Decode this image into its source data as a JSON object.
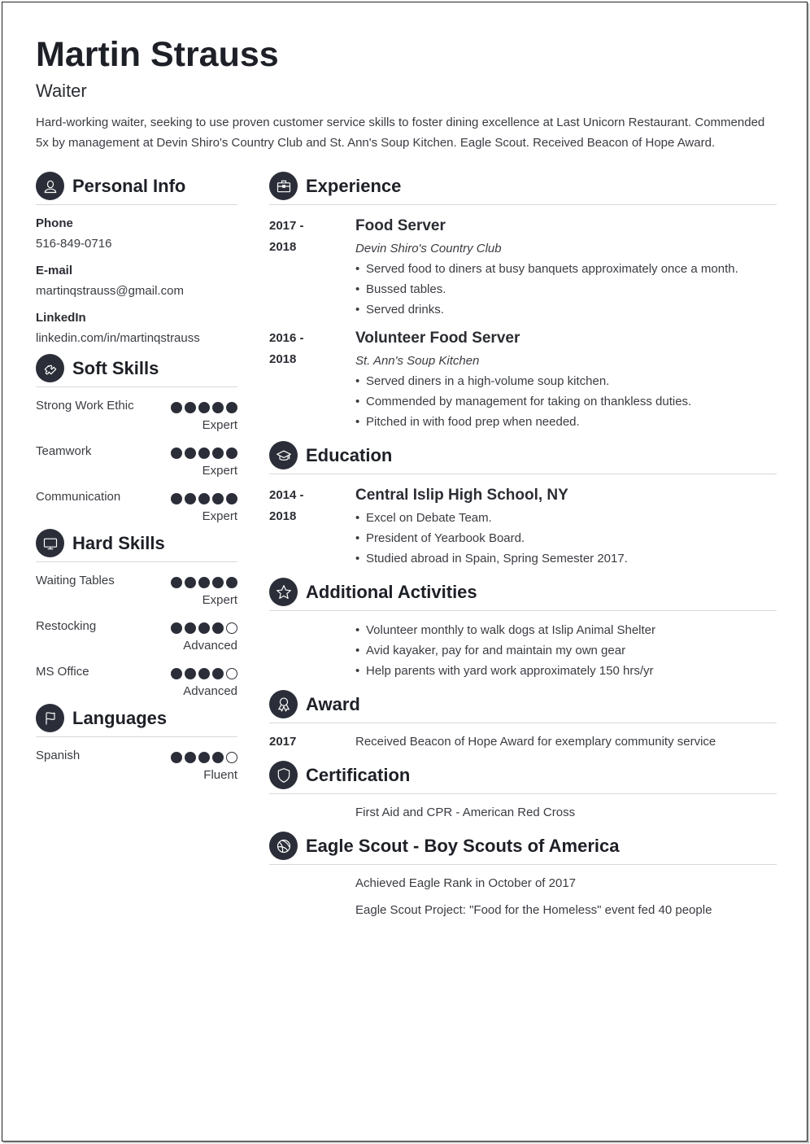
{
  "header": {
    "name": "Martin Strauss",
    "title": "Waiter",
    "summary": "Hard-working waiter, seeking to use proven customer service skills to foster dining excellence at Last Unicorn Restaurant. Commended 5x by management at Devin Shiro's Country Club and St. Ann's Soup Kitchen. Eagle Scout. Received Beacon of Hope Award."
  },
  "personal_info": {
    "title": "Personal Info",
    "icon": "person-icon",
    "fields": [
      {
        "label": "Phone",
        "value": "516-849-0716"
      },
      {
        "label": "E-mail",
        "value": "martinqstrauss@gmail.com"
      },
      {
        "label": "LinkedIn",
        "value": "linkedin.com/in/martinqstrauss"
      }
    ]
  },
  "soft_skills": {
    "title": "Soft Skills",
    "icon": "puzzle-icon",
    "items": [
      {
        "name": "Strong Work Ethic",
        "rating": 5,
        "max": 5,
        "level": "Expert"
      },
      {
        "name": "Teamwork",
        "rating": 5,
        "max": 5,
        "level": "Expert"
      },
      {
        "name": "Communication",
        "rating": 5,
        "max": 5,
        "level": "Expert"
      }
    ]
  },
  "hard_skills": {
    "title": "Hard Skills",
    "icon": "monitor-icon",
    "items": [
      {
        "name": "Waiting Tables",
        "rating": 5,
        "max": 5,
        "level": "Expert"
      },
      {
        "name": "Restocking",
        "rating": 4,
        "max": 5,
        "level": "Advanced"
      },
      {
        "name": "MS Office",
        "rating": 4,
        "max": 5,
        "level": "Advanced"
      }
    ]
  },
  "languages": {
    "title": "Languages",
    "icon": "flag-icon",
    "items": [
      {
        "name": "Spanish",
        "rating": 4,
        "max": 5,
        "level": "Fluent"
      }
    ]
  },
  "experience": {
    "title": "Experience",
    "icon": "briefcase-icon",
    "entries": [
      {
        "date_start": "2017 -",
        "date_end": "2018",
        "role": "Food Server",
        "org": "Devin Shiro's Country Club",
        "bullets": [
          "Served food to diners at busy banquets approximately once a month.",
          "Bussed tables.",
          "Served drinks."
        ]
      },
      {
        "date_start": "2016 -",
        "date_end": "2018",
        "role": "Volunteer Food Server",
        "org": "St. Ann's Soup Kitchen",
        "bullets": [
          "Served diners in a high-volume soup kitchen.",
          "Commended by management for taking on thankless duties.",
          "Pitched in with food prep when needed."
        ]
      }
    ]
  },
  "education": {
    "title": "Education",
    "icon": "graduation-cap-icon",
    "entries": [
      {
        "date_start": "2014 -",
        "date_end": "2018",
        "school": "Central Islip High School, NY",
        "bullets": [
          "Excel on Debate Team.",
          "President of Yearbook Board.",
          "Studied abroad in Spain, Spring Semester 2017."
        ]
      }
    ]
  },
  "activities": {
    "title": "Additional Activities",
    "icon": "star-icon",
    "bullets": [
      "Volunteer monthly to walk dogs at Islip Animal Shelter",
      "Avid kayaker, pay for and maintain my own gear",
      "Help parents with yard work approximately 150 hrs/yr"
    ]
  },
  "award": {
    "title": "Award",
    "icon": "ribbon-icon",
    "year": "2017",
    "text": "Received Beacon of Hope Award for exemplary community service"
  },
  "certification": {
    "title": "Certification",
    "icon": "shield-icon",
    "text": "First Aid and CPR - American Red Cross"
  },
  "eagle_scout": {
    "title": "Eagle Scout - Boy Scouts of America",
    "icon": "ball-icon",
    "lines": [
      "Achieved Eagle Rank in October of 2017",
      "Eagle Scout Project: \"Food for the Homeless\" event fed 40 people"
    ]
  }
}
